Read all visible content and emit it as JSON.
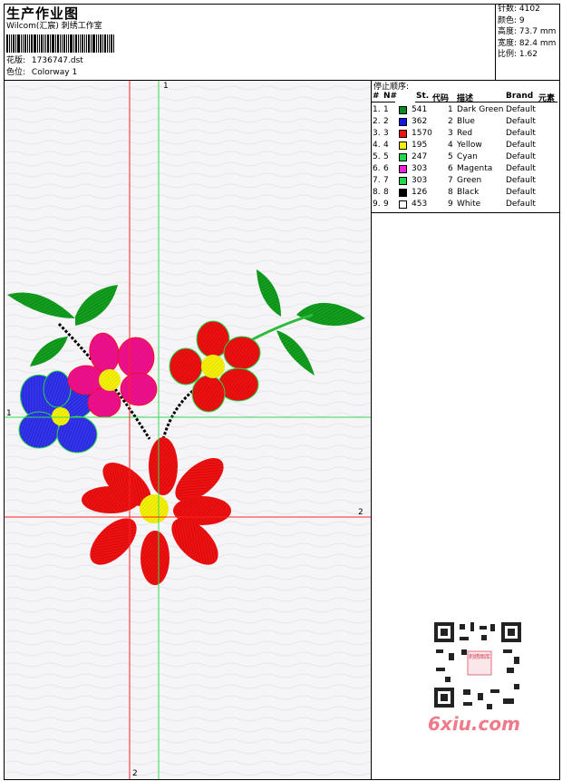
{
  "header": {
    "title": "生产作业图",
    "company": "Wilcom(汇宸) 刺绣工作室",
    "file_label": "花版:",
    "file_name": "1736747.dst",
    "colorway_label": "色位:",
    "colorway_name": "Colorway 1"
  },
  "stats": [
    {
      "label": "针数:",
      "value": "4102"
    },
    {
      "label": "颜色:",
      "value": "9"
    },
    {
      "label": "高度:",
      "value": "73.7 mm"
    },
    {
      "label": "宽度:",
      "value": "82.4 mm"
    },
    {
      "label": "比例:",
      "value": "1.62"
    }
  ],
  "legend": {
    "title": "停止顺序:",
    "columns": {
      "hash": "#",
      "n": "N#",
      "st": "St.",
      "code": "代码",
      "desc": "描述",
      "brand": "Brand",
      "elem": "元素"
    },
    "rows": [
      {
        "hash": "1.",
        "n": "1",
        "st": "541",
        "color": "#0a8a1e",
        "code": "1",
        "desc": "Dark Green",
        "brand": "Default"
      },
      {
        "hash": "2.",
        "n": "2",
        "st": "362",
        "color": "#1515e0",
        "code": "2",
        "desc": "Blue",
        "brand": "Default"
      },
      {
        "hash": "3.",
        "n": "3",
        "st": "1570",
        "color": "#ee1111",
        "code": "3",
        "desc": "Red",
        "brand": "Default"
      },
      {
        "hash": "4.",
        "n": "4",
        "st": "195",
        "color": "#f5f00a",
        "code": "4",
        "desc": "Yellow",
        "brand": "Default"
      },
      {
        "hash": "5.",
        "n": "5",
        "st": "247",
        "color": "#22d84a",
        "code": "5",
        "desc": "Cyan",
        "brand": "Default"
      },
      {
        "hash": "6.",
        "n": "6",
        "st": "303",
        "color": "#ee22dd",
        "code": "6",
        "desc": "Magenta",
        "brand": "Default"
      },
      {
        "hash": "7.",
        "n": "7",
        "st": "303",
        "color": "#22d84a",
        "code": "7",
        "desc": "Green",
        "brand": "Default"
      },
      {
        "hash": "8.",
        "n": "8",
        "st": "126",
        "color": "#000000",
        "code": "8",
        "desc": "Black",
        "brand": "Default"
      },
      {
        "hash": "9.",
        "n": "9",
        "st": "453",
        "color": "#ffffff",
        "code": "9",
        "desc": "White",
        "brand": "Default"
      }
    ]
  },
  "guides": {
    "green_1": "1",
    "red_2": "2"
  },
  "watermark": {
    "qr_badge": "刺绣图库",
    "text": "6xiu.com"
  }
}
